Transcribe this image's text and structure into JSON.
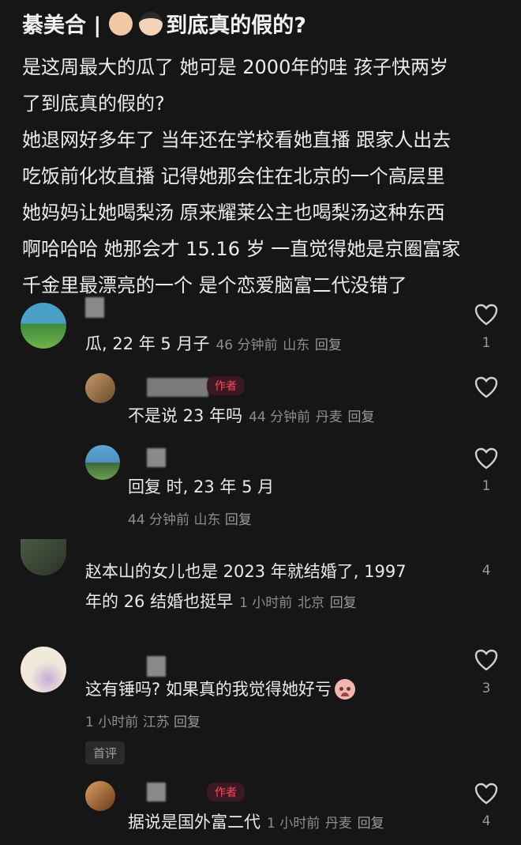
{
  "post": {
    "title_prefix": "綦美合 |",
    "title_suffix": "到底真的假的?",
    "lines": [
      "是这周最大的瓜了 她可是 2000年的哇 孩子快两岁",
      "了到底真的假的?",
      "她退网好多年了 当年还在学校看她直播 跟家人出去",
      "吃饭前化妆直播 记得她那会住在北京的一个高层里",
      "她妈妈让她喝梨汤 原来耀莱公主也喝梨汤这种东西",
      "啊哈哈哈 她那会才 15.16 岁 一直觉得她是京圈富家",
      "千金里最漂亮的一个 是个恋爱脑富二代没错了"
    ]
  },
  "comments": [
    {
      "text": "瓜, 22 年 5 月子",
      "time": "46 分钟前",
      "location": "山东",
      "reply": "回复",
      "likes": "1"
    },
    {
      "badge": "作者",
      "text": "不是说 23 年吗",
      "time": "44 分钟前",
      "location": "丹麦",
      "reply": "回复"
    },
    {
      "text": "回复 时, 23 年 5 月",
      "time": "44 分钟前",
      "location": "山东",
      "reply": "回复",
      "likes": "1"
    },
    {
      "text1": "赵本山的女儿也是 2023 年就结婚了, 1997",
      "text2": "年的 26 结婚也挺早",
      "time": "1 小时前",
      "location": "北京",
      "reply": "回复",
      "likes": "4"
    },
    {
      "text": "这有锤吗? 如果真的我觉得她好亏",
      "time": "1 小时前",
      "location": "江苏",
      "reply": "回复",
      "tag": "首评",
      "likes": "3"
    },
    {
      "badge": "作者",
      "text": "据说是国外富二代",
      "time": "1 小时前",
      "location": "丹麦",
      "reply": "回复",
      "likes": "4"
    }
  ],
  "icons": {
    "like": "heart-outline-icon"
  },
  "colors": {
    "background": "#161616",
    "badge": "#ff4a5f"
  }
}
